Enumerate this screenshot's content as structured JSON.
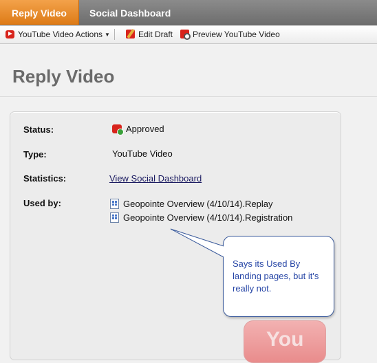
{
  "tabs": [
    {
      "label": "Reply Video",
      "active": true
    },
    {
      "label": "Social Dashboard",
      "active": false
    }
  ],
  "toolbar": {
    "actions_label": "YouTube Video Actions",
    "edit_label": "Edit Draft",
    "preview_label": "Preview YouTube Video"
  },
  "page": {
    "title": "Reply Video"
  },
  "details": {
    "status_label": "Status:",
    "status_value": "Approved",
    "type_label": "Type:",
    "type_value": "YouTube Video",
    "statistics_label": "Statistics:",
    "statistics_link": "View Social Dashboard",
    "used_by_label": "Used by:",
    "used_by": [
      "Geopointe Overview (4/10/14).Replay",
      "Geopointe Overview (4/10/14).Registration"
    ]
  },
  "callout": {
    "text": "Says its Used By landing pages, but it's really not."
  },
  "watermark": {
    "text": "You"
  },
  "colors": {
    "active_tab": "#f0953a",
    "tab_bar": "#7d7d7d",
    "link": "#1a1a60",
    "callout_text": "#2746a6",
    "callout_border": "#3b5b9c"
  }
}
